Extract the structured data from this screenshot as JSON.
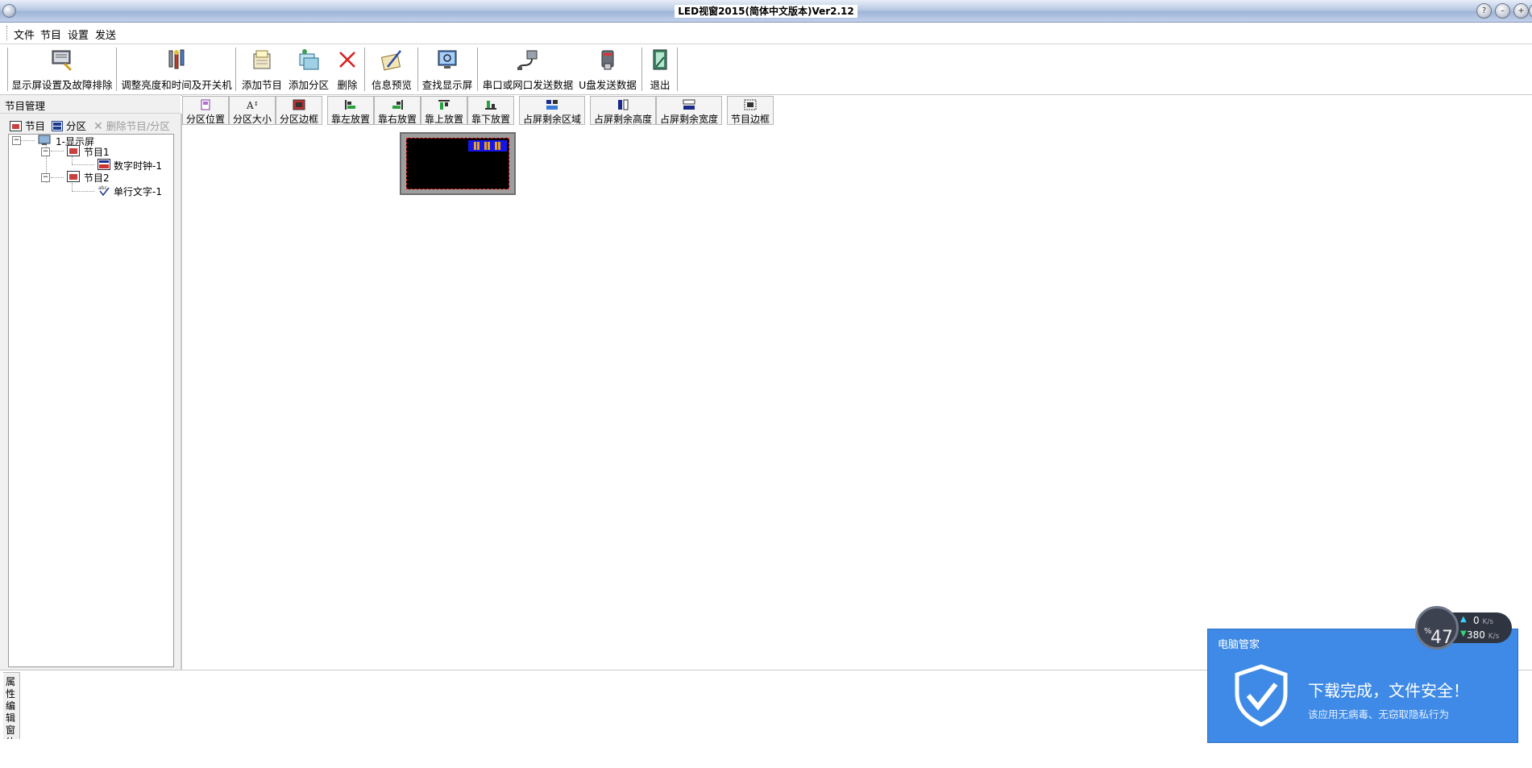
{
  "window": {
    "title": "LED视窗2015(简体中文版本)Ver2.12"
  },
  "menu": [
    "文件",
    "节目",
    "设置",
    "发送"
  ],
  "toolbar": [
    {
      "label": "显示屏设置及故障排除",
      "icon": "display-settings-icon"
    },
    {
      "label": "调整亮度和时间及开关机",
      "icon": "tools-icon"
    },
    {
      "label": "添加节目",
      "icon": "add-program-icon"
    },
    {
      "label": "添加分区",
      "icon": "add-zone-icon"
    },
    {
      "label": "删除",
      "icon": "delete-x-icon"
    },
    {
      "label": "信息预览",
      "icon": "preview-icon"
    },
    {
      "label": "查找显示屏",
      "icon": "find-screen-icon"
    },
    {
      "label": "串口或网口发送数据",
      "icon": "cable-icon"
    },
    {
      "label": "U盘发送数据",
      "icon": "usb-icon"
    },
    {
      "label": "退出",
      "icon": "exit-icon"
    }
  ],
  "left_panel": {
    "header": "节目管理",
    "actions": {
      "program": "节目",
      "zone": "分区",
      "delete": "删除节目/分区"
    },
    "tree": {
      "root": "1-显示屏",
      "program1": "节目1",
      "clock": "数字时钟-1",
      "program2": "节目2",
      "text": "单行文字-1"
    }
  },
  "sub_toolbar": [
    {
      "label": "分区位置",
      "icon": "zone-position-icon"
    },
    {
      "label": "分区大小",
      "icon": "zone-size-icon"
    },
    {
      "label": "分区边框",
      "icon": "zone-border-icon"
    },
    {
      "label": "靠左放置",
      "icon": "align-left-icon"
    },
    {
      "label": "靠右放置",
      "icon": "align-right-icon"
    },
    {
      "label": "靠上放置",
      "icon": "align-top-icon"
    },
    {
      "label": "靠下放置",
      "icon": "align-bottom-icon"
    },
    {
      "label": "占屏剩余区域",
      "icon": "fill-remaining-icon"
    },
    {
      "label": "占屏剩余高度",
      "icon": "fill-height-icon"
    },
    {
      "label": "占屏剩余宽度",
      "icon": "fill-width-icon"
    },
    {
      "label": "节目边框",
      "icon": "program-border-icon"
    }
  ],
  "property_tab": "属性编辑窗体",
  "security_popup": {
    "app": "电脑管家",
    "message": "下载完成，文件安全！",
    "detail": "该应用无病毒、无窃取隐私行为"
  },
  "speed_widget": {
    "percent": "47",
    "percent_unit": "%",
    "upload": "0",
    "download": "380",
    "unit": "K/s"
  },
  "colors": {
    "titlebar": "#b8c8e4",
    "popup_blue": "#3e8ae6",
    "clock_blue": "#1515e8",
    "preview_border": "#e02020"
  }
}
